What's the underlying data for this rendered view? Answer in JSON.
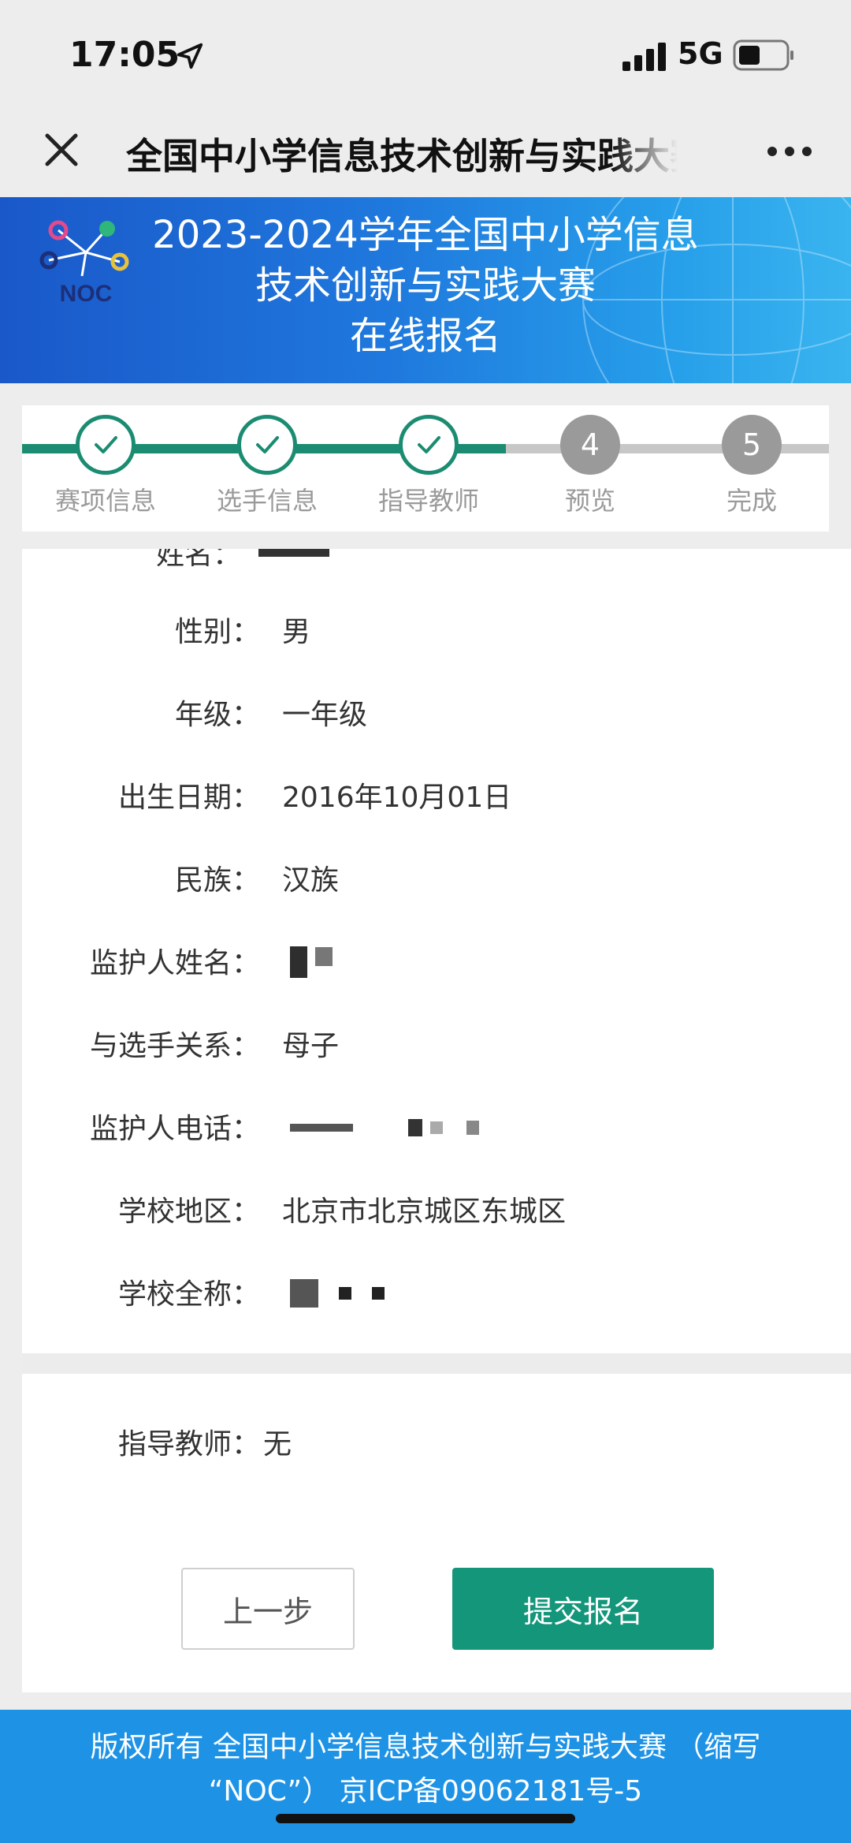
{
  "status_bar": {
    "time": "17:05",
    "network": "5G"
  },
  "nav": {
    "title": "全国中小学信息技术创新与实践大赛"
  },
  "banner": {
    "line1": "2023-2024学年全国中小学信息",
    "line2": "技术创新与实践大赛",
    "line3": "在线报名",
    "logo_text": "NOC"
  },
  "steps": [
    {
      "label": "赛项信息",
      "state": "done"
    },
    {
      "label": "选手信息",
      "state": "done"
    },
    {
      "label": "指导教师",
      "state": "done"
    },
    {
      "label": "预览",
      "number": "4",
      "state": "todo"
    },
    {
      "label": "完成",
      "number": "5",
      "state": "todo"
    }
  ],
  "form": {
    "partial_label": "姓名：",
    "rows": [
      {
        "label": "性别：",
        "value": "男"
      },
      {
        "label": "年级：",
        "value": "一年级"
      },
      {
        "label": "出生日期：",
        "value": "2016年10月01日"
      },
      {
        "label": "民族：",
        "value": "汉族"
      },
      {
        "label": "监护人姓名：",
        "value": ""
      },
      {
        "label": "与选手关系：",
        "value": "母子"
      },
      {
        "label": "监护人电话：",
        "value": ""
      },
      {
        "label": "学校地区：",
        "value": "北京市北京城区东城区"
      },
      {
        "label": "学校全称：",
        "value": ""
      }
    ],
    "teacher": {
      "label": "指导教师：",
      "value": "无"
    }
  },
  "buttons": {
    "prev": "上一步",
    "submit": "提交报名"
  },
  "footer": {
    "line1": "版权所有 全国中小学信息技术创新与实践大赛 （缩写",
    "line2": "“NOC”） 京ICP备09062181号-5"
  },
  "colors": {
    "accent": "#14967a",
    "banner": "#1f78dd",
    "footer": "#1e93e6"
  }
}
